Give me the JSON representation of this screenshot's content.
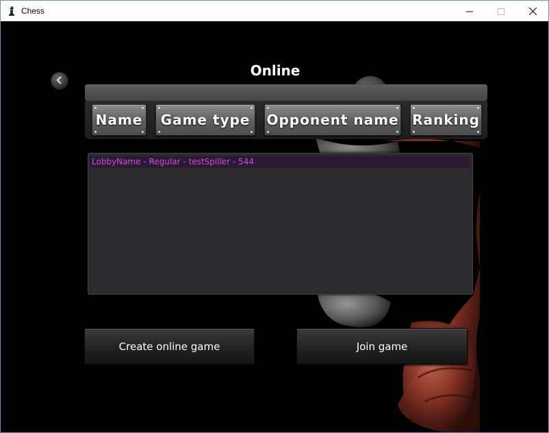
{
  "window": {
    "title": "Chess",
    "icon": "chess-pawn-icon",
    "controls": [
      "minimize-icon",
      "maximize-icon",
      "close-icon"
    ]
  },
  "screen": {
    "title": "Online",
    "back_icon": "chevron-left-icon",
    "columns": [
      "Name",
      "Game type",
      "Opponent name",
      "Ranking"
    ],
    "lobbies": [
      "LobbyName - Regular - testSpiller - 544"
    ],
    "create_label": "Create online game",
    "join_label": "Join game"
  },
  "colors": {
    "background": "#000000",
    "list_text": "#d34ad6",
    "list_panel": "#2b2b2d"
  }
}
